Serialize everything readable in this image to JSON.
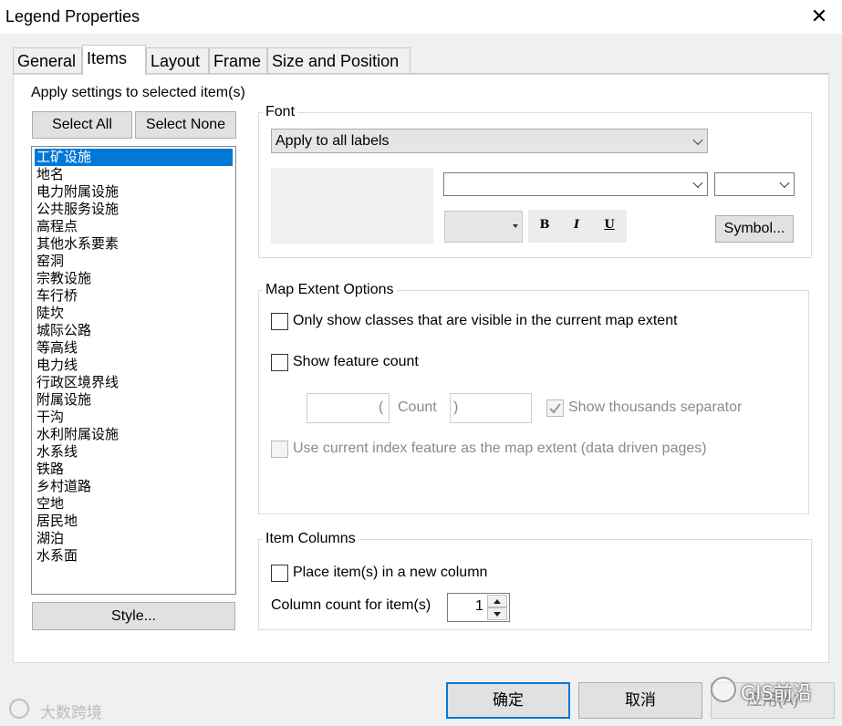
{
  "window": {
    "title": "Legend Properties",
    "close_glyph": "✕"
  },
  "tabs": [
    {
      "label": "General"
    },
    {
      "label": "Items",
      "active": true
    },
    {
      "label": "Layout"
    },
    {
      "label": "Frame"
    },
    {
      "label": "Size and Position"
    }
  ],
  "items_panel": {
    "apply_label": "Apply settings to selected item(s)",
    "select_all": "Select All",
    "select_none": "Select None",
    "items": [
      "工矿设施",
      "地名",
      "电力附属设施",
      "公共服务设施",
      "高程点",
      "其他水系要素",
      "窑洞",
      "宗教设施",
      "车行桥",
      "陡坎",
      "城际公路",
      "等高线",
      "电力线",
      "行政区境界线",
      "附属设施",
      "干沟",
      "水利附属设施",
      "水系线",
      "铁路",
      "乡村道路",
      "空地",
      "居民地",
      "湖泊",
      "水系面"
    ],
    "selected_index": 0,
    "style_button": "Style..."
  },
  "font_group": {
    "legend": "Font",
    "apply_to": "Apply to all labels",
    "font_name": "",
    "font_size": "",
    "bold": "B",
    "italic": "I",
    "underline": "U",
    "symbol_button": "Symbol..."
  },
  "map_extent": {
    "legend": "Map Extent Options",
    "only_visible": "Only show classes that are visible in the current map extent",
    "show_count": "Show feature count",
    "prefix_value": "(",
    "count_label": "Count",
    "suffix_value": ")",
    "thousands_sep": "Show thousands separator",
    "thousands_checked": true,
    "use_index": "Use current index feature as the map extent (data driven pages)"
  },
  "item_columns": {
    "legend": "Item Columns",
    "new_column": "Place item(s) in a new column",
    "column_count_label": "Column count for item(s)",
    "column_count": "1"
  },
  "footer": {
    "ok": "确定",
    "cancel": "取消",
    "apply": "应用(A)"
  },
  "watermarks": {
    "left": "大数跨境",
    "right": "GIS前沿"
  },
  "colors": {
    "selection": "#0078d7",
    "ok_border": "#0078d7"
  }
}
